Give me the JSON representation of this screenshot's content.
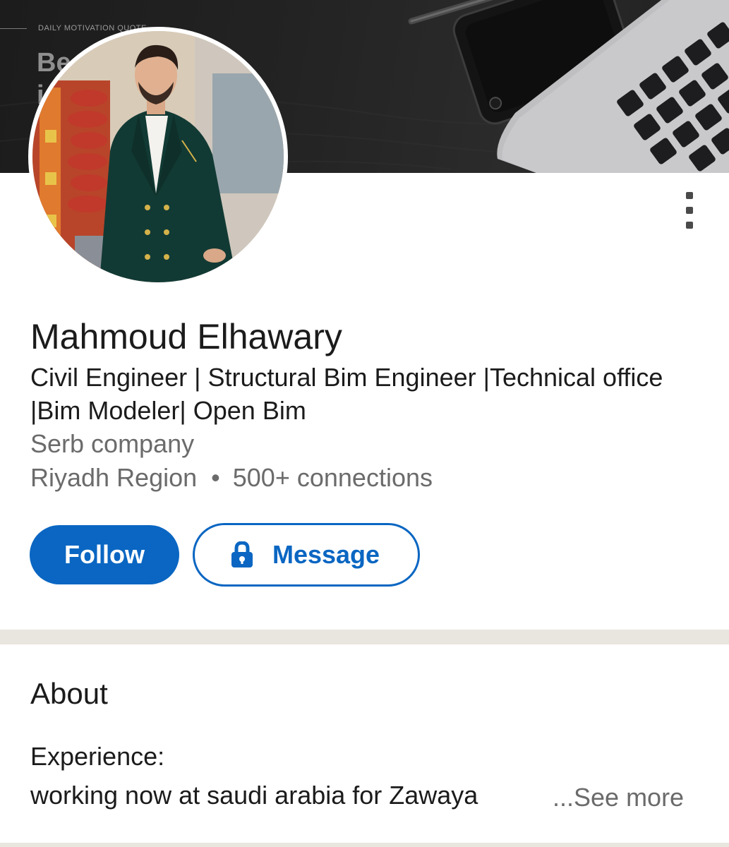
{
  "cover": {
    "kicker": "DAILY MOTIVATION QUOTE",
    "quote_fragment": "Be\ni"
  },
  "profile": {
    "name": "Mahmoud Elhawary",
    "headline": "Civil Engineer | Structural Bim Engineer |Technical office |Bim Modeler| Open Bim",
    "company": "Serb company",
    "location": "Riyadh Region",
    "separator": "•",
    "connections": "500+ connections"
  },
  "actions": {
    "follow_label": "Follow",
    "message_label": "Message"
  },
  "about": {
    "title": "About",
    "line1": "Experience:",
    "line2": "working now at saudi arabia for Zawaya",
    "see_more_label": "...See more"
  },
  "icons": {
    "more": "more-vertical-icon",
    "lock": "lock-icon"
  },
  "colors": {
    "accent": "#0a66c2",
    "text_primary": "#1b1b1b",
    "text_secondary": "#6b6b6b",
    "divider": "#e9e5df"
  }
}
